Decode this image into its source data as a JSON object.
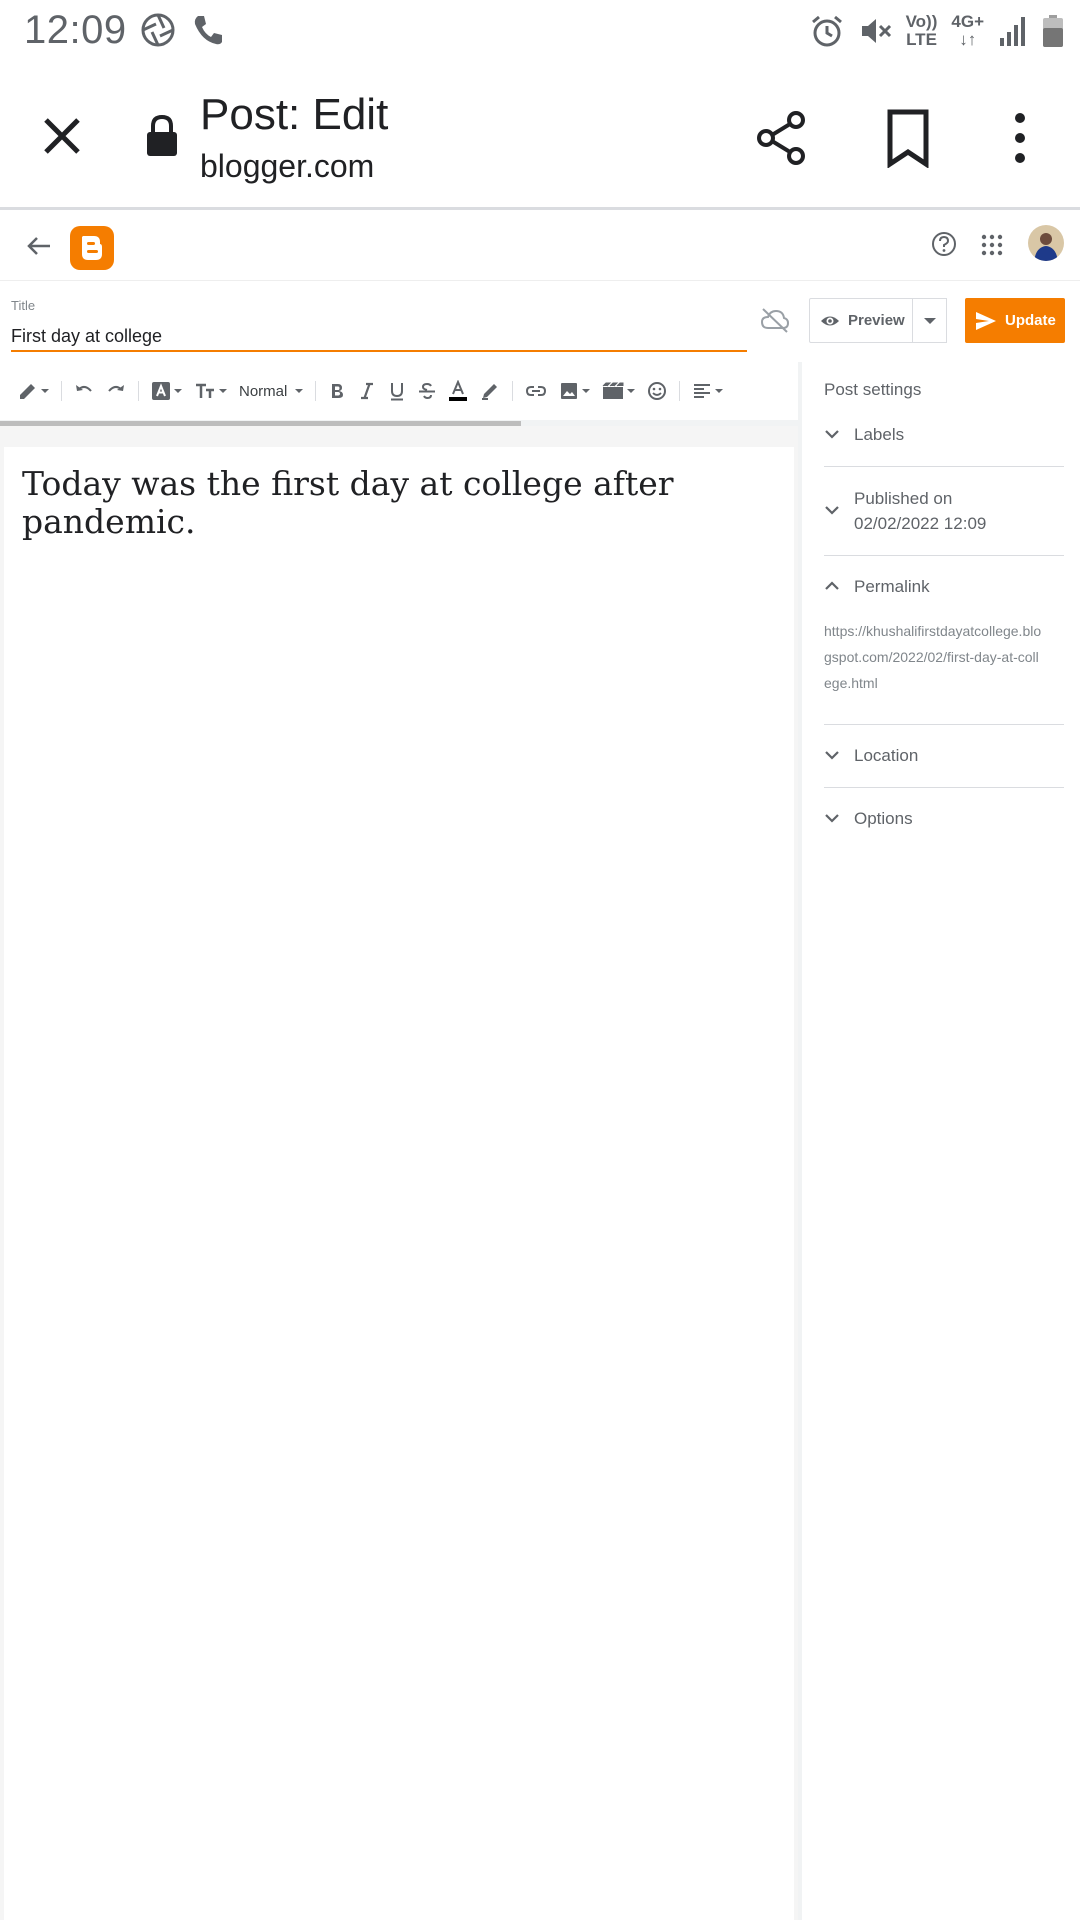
{
  "status_bar": {
    "time": "12:09",
    "volte_top": "Vo))",
    "volte_bottom": "LTE",
    "network": "4G+"
  },
  "custom_tab": {
    "title": "Post: Edit",
    "url": "blogger.com"
  },
  "editor": {
    "title_label": "Title",
    "title_value": "First day at college",
    "preview_label": "Preview",
    "update_label": "Update",
    "toolbar": {
      "paragraph_style": "Normal"
    },
    "body_text": "Today was the first day at college after pandemic."
  },
  "post_settings": {
    "heading": "Post settings",
    "labels": "Labels",
    "published_label": "Published on",
    "published_value": "02/02/2022 12:09",
    "permalink_label": "Permalink",
    "permalink_url": "https://khushalifirstdayatcollege.blogspot.com/2022/02/first-day-at-college.html",
    "location": "Location",
    "options": "Options"
  },
  "colors": {
    "accent": "#f57d00",
    "text": "#202124",
    "muted": "#5f6368"
  }
}
